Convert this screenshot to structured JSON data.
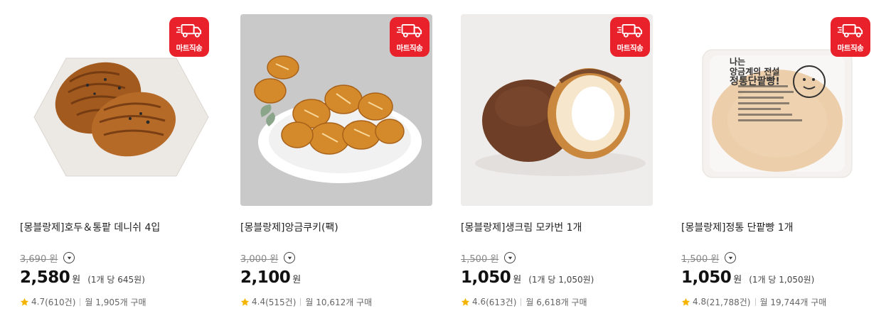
{
  "badge_label": "마트직송",
  "currency": "원",
  "products": [
    {
      "title": "[몽블랑제]호두＆통팥 데니쉬 4입",
      "original_price": "3,690",
      "price": "2,580",
      "unit_price": "(1개 당 645원)",
      "rating": "4.7",
      "reviews": "(610건)",
      "monthly": "월 1,905개 구매",
      "image": "walnut-redbean-danish-on-marble"
    },
    {
      "title": "[몽블랑제]앙금쿠키(팩)",
      "original_price": "3,000",
      "price": "2,100",
      "unit_price": "",
      "rating": "4.4",
      "reviews": "(515건)",
      "monthly": "월 10,612개 구매",
      "image": "bean-paste-cookies-on-plate"
    },
    {
      "title": "[몽블랑제]생크림 모카번 1개",
      "original_price": "1,500",
      "price": "1,050",
      "unit_price": "(1개 당 1,050원)",
      "rating": "4.6",
      "reviews": "(613건)",
      "monthly": "월 6,618개 구매",
      "image": "mocha-bun-with-cream"
    },
    {
      "title": "[몽블랑제]정통 단팥빵 1개",
      "original_price": "1,500",
      "price": "1,050",
      "unit_price": "(1개 당 1,050원)",
      "rating": "4.8",
      "reviews": "(21,788건)",
      "monthly": "월 19,744개 구매",
      "image": "packaged-redbean-bread"
    }
  ],
  "package_print": {
    "l1": "나는",
    "l2": "앙금계의 전설",
    "l3": "정통단팥빵!"
  },
  "colors": {
    "badge": "#e8212b",
    "star": "#f5b400",
    "price": "#111111",
    "strike": "#888888"
  }
}
